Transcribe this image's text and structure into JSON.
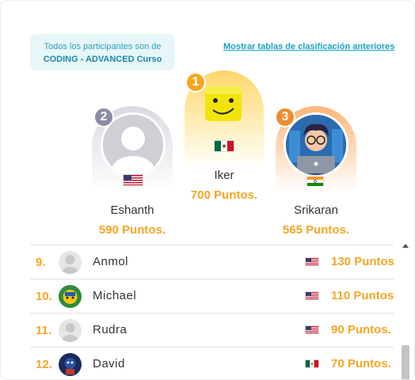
{
  "info": {
    "line1": "Todos los participantes son de",
    "line2": "CODING - ADVANCED Curso"
  },
  "previous_link": "Mostrar tablas de clasificación anteriores",
  "podium": [
    {
      "rank": "1",
      "name": "Iker",
      "points": "700 Puntos.",
      "flag": "mexico-flag-icon"
    },
    {
      "rank": "2",
      "name": "Eshanth",
      "points": "590 Puntos.",
      "flag": "usa-flag-icon"
    },
    {
      "rank": "3",
      "name": "Srikaran",
      "points": "565 Puntos.",
      "flag": "india-flag-icon"
    }
  ],
  "list": [
    {
      "rank": "9.",
      "name": "Anmol",
      "points": "130 Puntos.",
      "flag": "usa-flag-icon"
    },
    {
      "rank": "10.",
      "name": "Michael",
      "points": "110 Puntos.",
      "flag": "usa-flag-icon"
    },
    {
      "rank": "11.",
      "name": "Rudra",
      "points": "90 Puntos.",
      "flag": "usa-flag-icon"
    },
    {
      "rank": "12.",
      "name": "David",
      "points": "70 Puntos.",
      "flag": "mexico-flag-icon"
    }
  ],
  "colors": {
    "accent": "#f5a623",
    "link": "#1aa3c0",
    "info_bg": "#e7f6f9"
  }
}
